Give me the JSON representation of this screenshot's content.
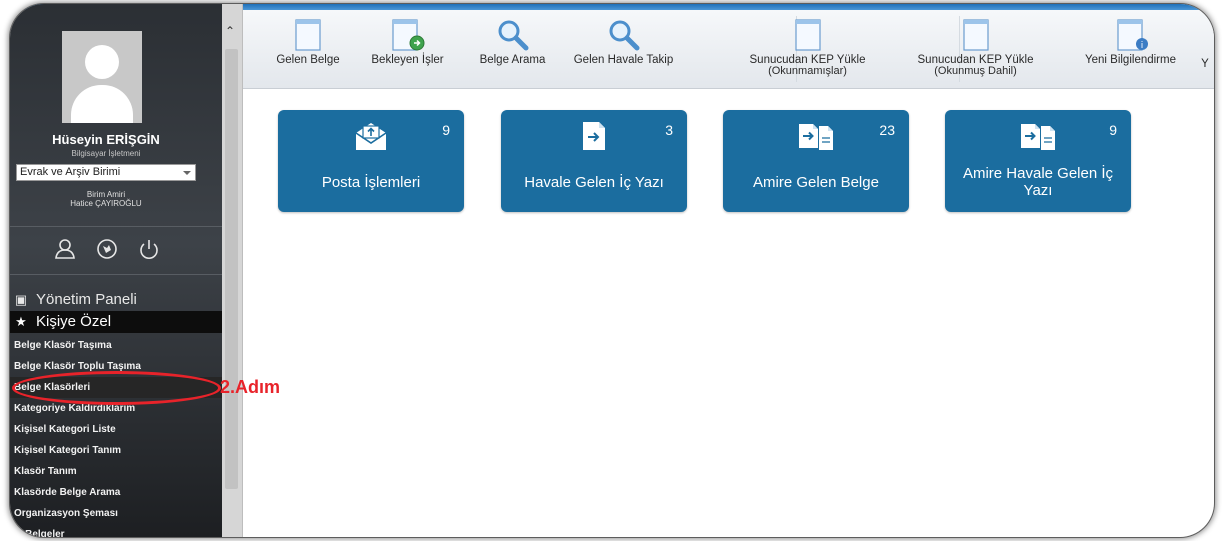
{
  "user": {
    "name": "Hüseyin ERİŞGİN",
    "department": "Bilgisayar İşletmeni",
    "unit_selected": "Evrak ve Arşiv Birimi",
    "manager_title": "Birim Amiri",
    "manager_name": "Hatice ÇAYIROĞLU"
  },
  "sidebar": {
    "action_icons": [
      "user-icon",
      "globe-icon",
      "power-icon"
    ],
    "sections": {
      "yonetim": "Yönetim Paneli",
      "kisiye": "Kişiye Özel"
    },
    "items": [
      {
        "label": "Belge Klasör Taşıma"
      },
      {
        "label": "Belge Klasör Toplu Taşıma"
      },
      {
        "label": "Belge Klasörleri"
      },
      {
        "label": "Kategoriye Kaldırdıklarım"
      },
      {
        "label": "Kişisel Kategori Liste"
      },
      {
        "label": "Kişisel Kategori Tanım"
      },
      {
        "label": "Klasör Tanım"
      },
      {
        "label": "Klasörde Belge Arama"
      },
      {
        "label": "Organizasyon Şeması"
      },
      {
        "label": "... Belgeler"
      }
    ]
  },
  "toolbar": {
    "items": [
      {
        "label": "Gelen Belge",
        "icon": "document-icon"
      },
      {
        "label": "Bekleyen İşler",
        "icon": "document-pending-icon"
      },
      {
        "label": "Belge Arama",
        "icon": "magnifier-icon"
      },
      {
        "label": "Gelen Havale Takip",
        "icon": "magnifier-icon"
      },
      {
        "label": "Sunucudan KEP Yükle",
        "sublabel": "(Okunmamışlar)",
        "icon": "document-icon"
      },
      {
        "label": "Sunucudan KEP Yükle",
        "sublabel": "(Okunmuş Dahil)",
        "icon": "document-icon"
      },
      {
        "label": "Yeni Bilgilendirme",
        "icon": "document-info-icon"
      }
    ],
    "overflow_glyph": "Y"
  },
  "tiles": [
    {
      "label": "Posta İşlemleri",
      "count": "9",
      "icon": "mail-envelope-icon"
    },
    {
      "label": "Havale Gelen İç Yazı",
      "count": "3",
      "icon": "document-arrow-icon"
    },
    {
      "label": "Amire Gelen Belge",
      "count": "23",
      "icon": "documents-arrow-icon"
    },
    {
      "label": "Amire Havale Gelen İç Yazı",
      "count": "9",
      "icon": "documents-arrow-icon"
    }
  ],
  "annotation": {
    "text": "2.Adım",
    "color": "#e8232a"
  },
  "colors": {
    "tile": "#1b6d9f",
    "sidebar": "#3d4248",
    "annotation": "#e8232a",
    "accent_line": "#1f70b8"
  }
}
